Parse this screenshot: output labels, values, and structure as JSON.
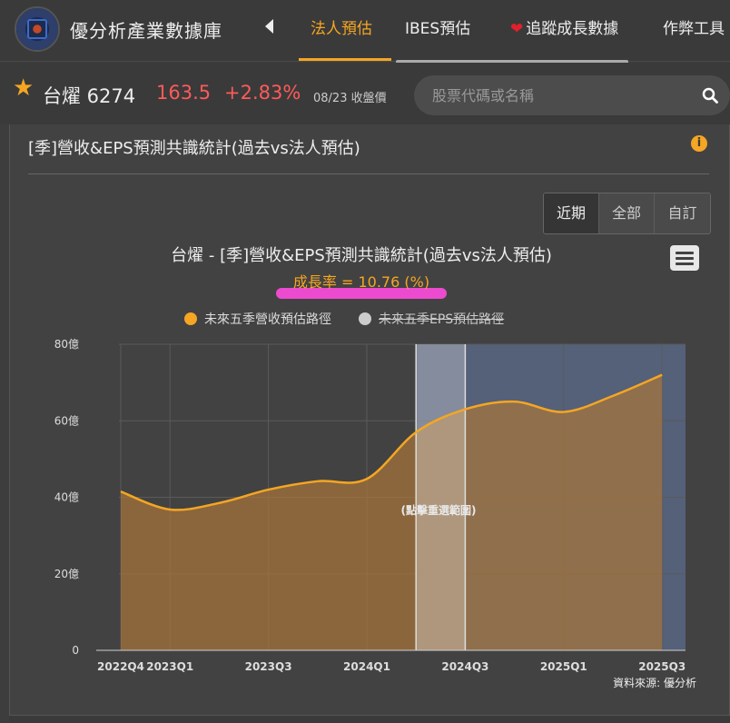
{
  "site": {
    "title": "優分析產業數據庫"
  },
  "nav": {
    "tabs": [
      {
        "label": "法人預估",
        "active": true
      },
      {
        "label": "IBES預估",
        "active": false
      },
      {
        "label": "追蹤成長數據",
        "active": false
      },
      {
        "label": "作弊工具",
        "active": false
      }
    ]
  },
  "stock": {
    "name": "台燿 6274",
    "price": "163.5",
    "change": "+2.83%",
    "date": "08/23 收盤價",
    "up_color": "#ff5a5a"
  },
  "search": {
    "placeholder": "股票代碼或名稱"
  },
  "panel": {
    "title": "[季]營收&EPS預測共識統計(過去vs法人預估)",
    "range_buttons": [
      {
        "label": "近期",
        "active": true
      },
      {
        "label": "全部",
        "active": false
      },
      {
        "label": "自訂",
        "active": false
      }
    ],
    "source": "資料來源: 優分析"
  },
  "chart_data": {
    "type": "area",
    "title": "台燿 - [季]營收&EPS預測共識統計(過去vs法人預估)",
    "subtitle": "成長率 = 10.76 (%)",
    "x_tick_labels": [
      "2022Q4",
      "2023Q1",
      "2023Q3",
      "2024Q1",
      "2024Q3",
      "2025Q1",
      "2025Q3"
    ],
    "x": [
      "2022Q4",
      "2023Q1",
      "2023Q2",
      "2023Q3",
      "2023Q4",
      "2024Q1",
      "2024Q2",
      "2024Q3",
      "2024Q4",
      "2025Q1",
      "2025Q2",
      "2025Q3"
    ],
    "series": [
      {
        "name": "未來五季營收預估路徑",
        "visible": true,
        "color": "#f5a623",
        "values": [
          41.5,
          36.8,
          38.5,
          42,
          44.2,
          44.8,
          57,
          63,
          65,
          62.3,
          66.5,
          72
        ]
      },
      {
        "name": "未來五季EPS預估路徑",
        "visible": false,
        "color": "#cccccc",
        "values": []
      }
    ],
    "y_ticks": [
      "0",
      "20億",
      "40億",
      "60億",
      "80億"
    ],
    "ylim": [
      0,
      80
    ],
    "selection_label": "(點擊重選範圍)",
    "selection_range": [
      "2024Q2",
      "2024Q3"
    ],
    "forecast_start": "2024Q2",
    "legend_position": "top",
    "grid": true
  }
}
